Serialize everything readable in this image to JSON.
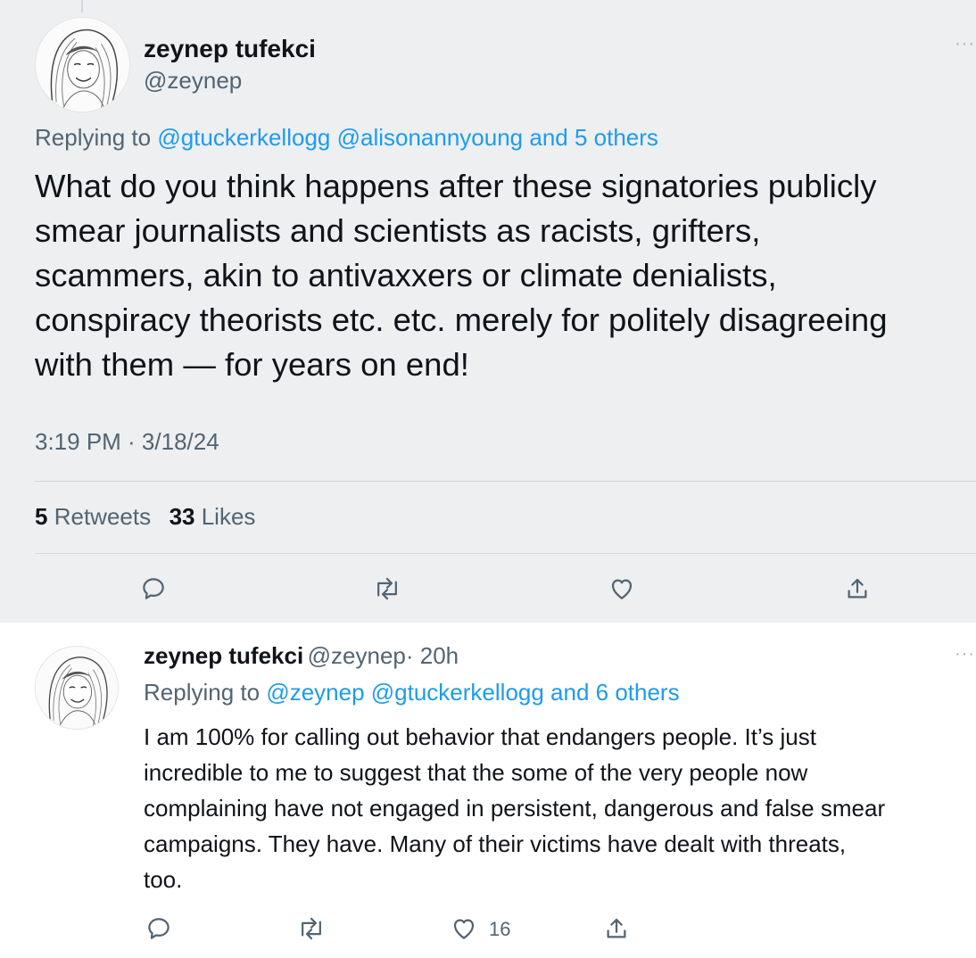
{
  "main_tweet": {
    "author_name": "zeynep tufekci",
    "author_handle": "@zeynep",
    "replying_prefix": "Replying to ",
    "replying_to": "@gtuckerkellogg @alisonannyoung and 5 others",
    "text": "What do you think happens after these signatories publicly\nsmear journalists and scientists as racists, grifters,\nscammers, akin to antivaxxers or climate denialists,\nconspiracy theorists etc. etc. merely for politely disagreeing\nwith them — for years on end!",
    "timestamp": "3:19 PM · 3/18/24",
    "retweets_count": "5",
    "retweets_label": "Retweets",
    "likes_count": "33",
    "likes_label": "Likes",
    "more_icon": "more-dots-icon"
  },
  "reply_tweet": {
    "author_name": "zeynep tufekci",
    "author_handle": "@zeynep",
    "time": "· 20h",
    "replying_prefix": "Replying to ",
    "replying_to": "@zeynep @gtuckerkellogg and 6 others",
    "text": "I am 100% for calling out behavior that endangers people. It’s just\nincredible to me to suggest that the some of the very people now\ncomplaining have not engaged in persistent, dangerous and false smear\ncampaigns. They have. Many of their victims have dealt with threats,\ntoo.",
    "like_count": "16"
  },
  "icons": {
    "reply": "reply-icon",
    "retweet": "retweet-icon",
    "like": "heart-icon",
    "share": "share-icon"
  },
  "colors": {
    "link": "#1d9bf0",
    "secondary_text": "#536471",
    "primary_text": "#0f1419",
    "highlight_bg": "#edeff1"
  }
}
